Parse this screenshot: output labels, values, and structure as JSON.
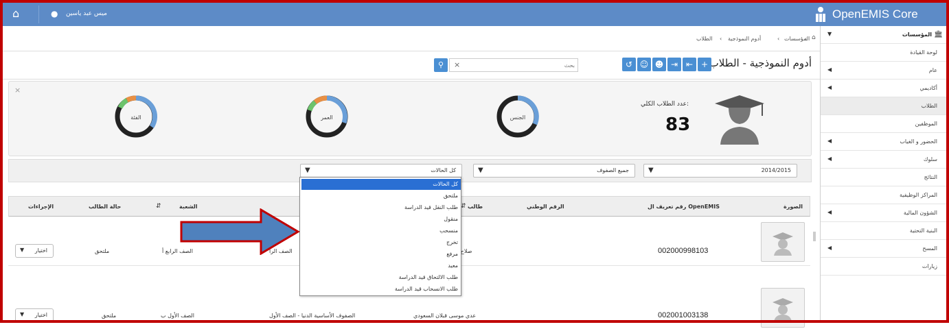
{
  "topbar": {
    "home_icon": "home-icon",
    "user_icon": "user-icon",
    "user_name": "ميس عبد ياسين",
    "brand": "OpenEMIS Core",
    "color": "#5d8bc7"
  },
  "sidebar": {
    "header": "المؤسسات",
    "items": [
      {
        "label": "لوحة القيادة",
        "arrow": false
      },
      {
        "label": "عام",
        "arrow": true
      },
      {
        "label": "أكاديمي",
        "arrow": true
      },
      {
        "label": "الطلاب",
        "arrow": false,
        "active": true
      },
      {
        "label": "الموظفين",
        "arrow": false
      },
      {
        "label": "الحضور و الغياب",
        "arrow": true
      },
      {
        "label": "سلوك",
        "arrow": true
      },
      {
        "label": "النتائج",
        "arrow": false
      },
      {
        "label": "المراكز الوظيفية",
        "arrow": false
      },
      {
        "label": "الشؤون المالية",
        "arrow": true
      },
      {
        "label": "البنية التحتية",
        "arrow": false
      },
      {
        "label": "المسح",
        "arrow": true
      },
      {
        "label": "زيارات",
        "arrow": false
      }
    ]
  },
  "breadcrumb": {
    "items": [
      "المؤسسات",
      "أدوم النموذجية",
      "الطلاب"
    ]
  },
  "page": {
    "title": "أدوم النموذجية - الطلاب",
    "search_placeholder": "بحث"
  },
  "dashboard": {
    "total_label": "عدد الطلاب الكلي:",
    "total_value": "83",
    "donuts": [
      {
        "label": "الجنس"
      },
      {
        "label": "العمر"
      },
      {
        "label": "الفئة"
      }
    ]
  },
  "filters": {
    "year": "2014/2015",
    "grade": "جميع الصفوف",
    "status": "كل الحالات"
  },
  "status_dropdown": {
    "options": [
      "كل الحالات",
      "ملتحق",
      "طلب النقل قيد الدراسة",
      "منقول",
      "منسحب",
      "تخرج",
      "مرفع",
      "معيد",
      "طلب الالتحاق قيد الدراسة",
      "طلب الانسحاب قيد الدراسة"
    ],
    "selected": 0
  },
  "table": {
    "headers": {
      "photo": "الصورة",
      "openemis_id": "رقم تعريف ال OpenEMIS",
      "national_id": "الرقم الوطني",
      "student": "طالب",
      "class": "الشعبة",
      "status": "حالة الطالب",
      "actions": "الإجراءات"
    },
    "rows": [
      {
        "openemis_id": "002000998103",
        "student": "صلاح سالم عودة",
        "education_grade": "الصف الرا",
        "class": "الصف الرابع أ",
        "status": "ملتحق",
        "action": "اختيار"
      },
      {
        "openemis_id": "002001003138",
        "student": "عدي موسى قبلان السعودي",
        "education_grade": "الصفوف الأساسية الدنيا - الصف الأول",
        "class": "الصف الأول ب",
        "status": "ملتحق",
        "action": "اختيار"
      }
    ]
  },
  "colors": {
    "accent": "#4a8fd3",
    "frame": "#c00000",
    "arrow_fill": "#4f81bd",
    "arrow_border": "#c00000",
    "selected_option": "#2a6fd3"
  }
}
